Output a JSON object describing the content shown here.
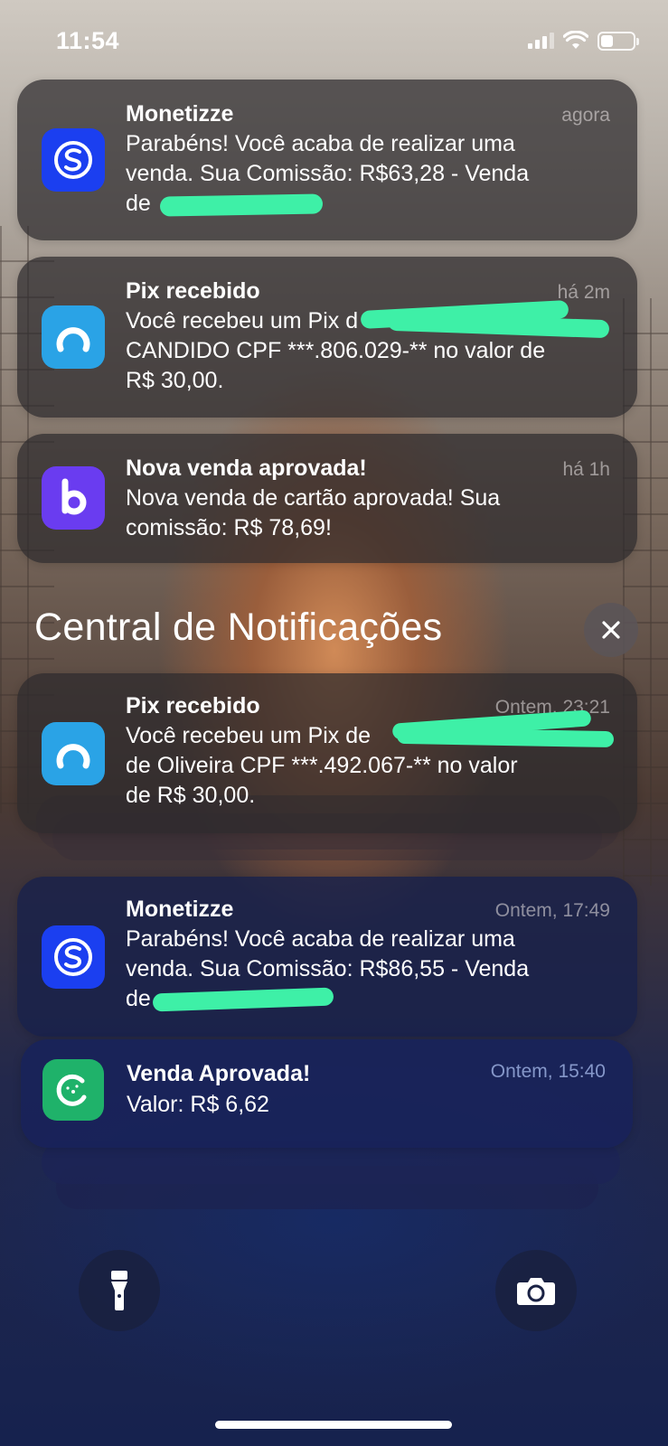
{
  "status_bar": {
    "time": "11:54"
  },
  "notifications_top": [
    {
      "app": "Monetizze",
      "title": "Monetizze",
      "time": "agora",
      "icon": "monetizze-icon",
      "icon_color": "#1b3ff0",
      "body_lines": [
        "Parabéns! Você acaba de realizar uma",
        "venda. Sua Comissão: R$63,28 - Venda",
        "de"
      ]
    },
    {
      "app": "Pix",
      "title": "Pix recebido",
      "time": "há 2m",
      "icon": "pix-bank-icon",
      "icon_color": "#2aa3e6",
      "body_lines": [
        "Você recebeu um Pix d",
        "CANDIDO CPF ***.806.029-** no valor de",
        "R$ 30,00."
      ]
    },
    {
      "app": "Braip",
      "title": "Nova venda aprovada!",
      "time": "há 1h",
      "icon": "braip-b-icon",
      "icon_color": "#6a3cf0",
      "body_lines": [
        "Nova venda de cartão aprovada! Sua",
        "comissão: R$ 78,69!"
      ]
    }
  ],
  "section": {
    "title": "Central de Notificações",
    "clear_icon": "close-icon"
  },
  "notifications_center": [
    {
      "app": "Pix",
      "title": "Pix recebido",
      "time": "Ontem, 23:21",
      "icon": "pix-bank-icon",
      "icon_color": "#2aa3e6",
      "body_lines": [
        "Você recebeu um Pix de",
        "de Oliveira CPF ***.492.067-** no valor",
        "de R$ 30,00."
      ]
    },
    {
      "app": "Monetizze",
      "title": "Monetizze",
      "time": "Ontem, 17:49",
      "icon": "monetizze-icon",
      "icon_color": "#1b3ff0",
      "body_lines": [
        "Parabéns! Você acaba de realizar uma",
        "venda. Sua Comissão: R$86,55 - Venda",
        "de"
      ]
    },
    {
      "app": "Kiwify",
      "title": "Venda Aprovada!",
      "time": "Ontem, 15:40",
      "icon": "kiwify-icon",
      "icon_color": "#1fb26a",
      "body_lines": [
        "Valor: R$ 6,62"
      ]
    }
  ],
  "bottom_controls": {
    "left": "flashlight-icon",
    "right": "camera-icon"
  }
}
